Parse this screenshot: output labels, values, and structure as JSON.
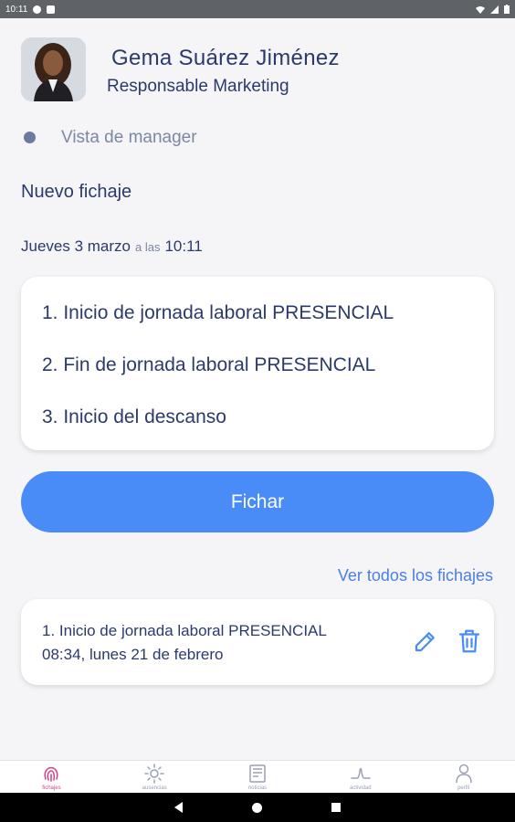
{
  "status_bar": {
    "time": "10:11"
  },
  "profile": {
    "name": "Gema Suárez Jiménez",
    "role": "Responsable Marketing",
    "manager_view_label": "Vista de manager"
  },
  "clock_in": {
    "title": "Nuevo fichaje",
    "date": "Jueves 3 marzo",
    "at_label": "a las",
    "time": "10:11",
    "options": [
      "1. Inicio de jornada laboral PRESENCIAL",
      "2. Fin de jornada laboral PRESENCIAL",
      "3. Inicio del descanso"
    ],
    "button_label": "Fichar",
    "view_all_label": "Ver todos los fichajes"
  },
  "last_record": {
    "type": "1. Inicio de jornada laboral PRESENCIAL",
    "when": "08:34, lunes 21 de febrero"
  },
  "bottom_nav": [
    {
      "label": "fichajes",
      "icon": "fingerprint-icon",
      "active": true
    },
    {
      "label": "ausencias",
      "icon": "sun-icon",
      "active": false
    },
    {
      "label": "noticias",
      "icon": "news-icon",
      "active": false
    },
    {
      "label": "actividad",
      "icon": "activity-icon",
      "active": false
    },
    {
      "label": "perfil",
      "icon": "user-icon",
      "active": false
    }
  ],
  "colors": {
    "primary": "#4a8cf7",
    "text": "#2b3a6b",
    "active_nav": "#d13f8a"
  }
}
